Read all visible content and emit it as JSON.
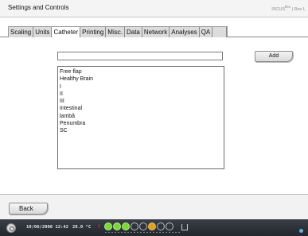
{
  "window": {
    "title": "Settings and Controls",
    "brand": "ISCUS",
    "brand_sup": "flex",
    "brand_suffix": " | Rev L"
  },
  "tabs": [
    "Scaling",
    "Units",
    "Catheter",
    "Printing",
    "Misc.",
    "Data",
    "Network",
    "Analyses",
    "QA"
  ],
  "active_tab": "Catheter",
  "form": {
    "name_value": "",
    "add_label": "Add"
  },
  "catheter_list": [
    "Free flap",
    "Healthy Brain",
    "I",
    "II",
    "III",
    "Intestinal",
    "lambå",
    "Penumbra",
    "SC"
  ],
  "footer": {
    "back_label": "Back"
  },
  "status": {
    "datetime": "10/06/2008 12:42",
    "temperature": "28.0 °C",
    "alert_symbol": "!",
    "channel_states": [
      "active",
      "active",
      "active",
      "off",
      "off",
      "warn",
      "off",
      "off"
    ],
    "colors": {
      "active": "#7ad63a",
      "warn": "#e0a020",
      "alert": "#e03030"
    }
  }
}
